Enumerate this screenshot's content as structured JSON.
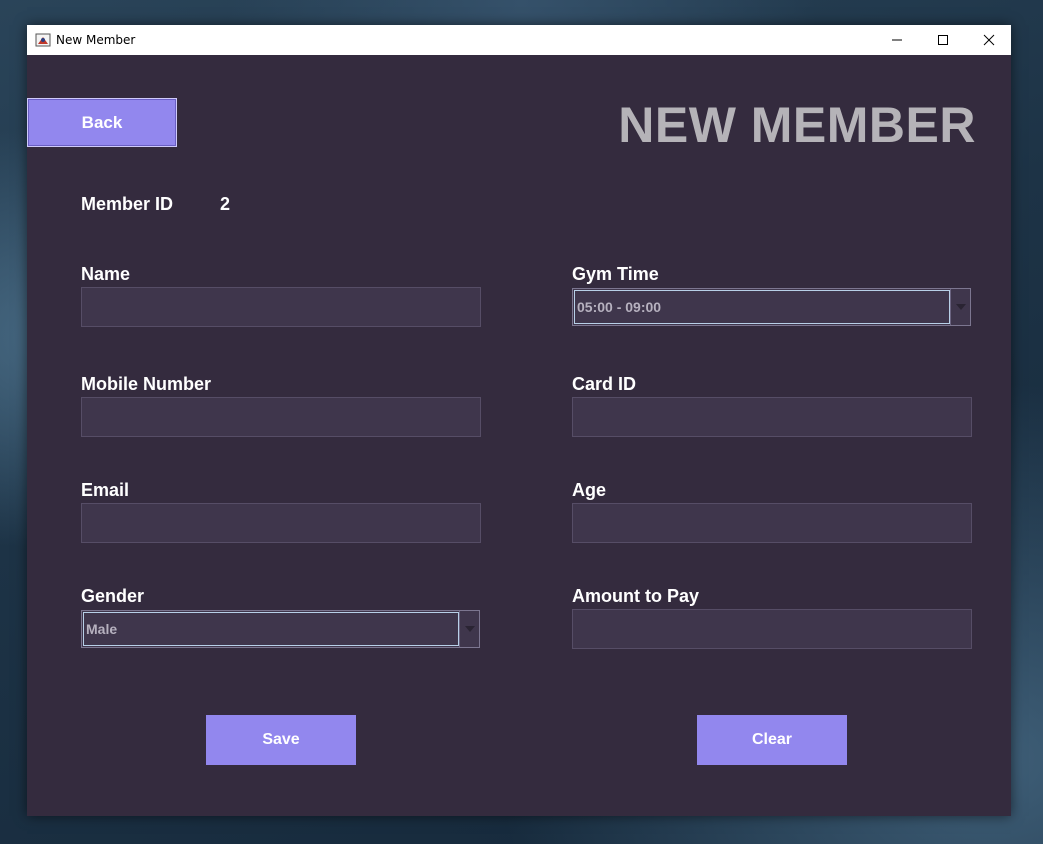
{
  "window": {
    "title": "New Member"
  },
  "header": {
    "back_label": "Back",
    "page_title": "NEW MEMBER"
  },
  "member": {
    "id_label": "Member ID",
    "id_value": "2"
  },
  "form": {
    "name": {
      "label": "Name",
      "value": ""
    },
    "mobile": {
      "label": "Mobile Number",
      "value": ""
    },
    "email": {
      "label": "Email",
      "value": ""
    },
    "gender": {
      "label": "Gender",
      "selected": "Male"
    },
    "gym_time": {
      "label": "Gym Time",
      "selected": "05:00 - 09:00"
    },
    "card_id": {
      "label": "Card ID",
      "value": ""
    },
    "age": {
      "label": "Age",
      "value": ""
    },
    "amount": {
      "label": "Amount to Pay",
      "value": ""
    }
  },
  "actions": {
    "save_label": "Save",
    "clear_label": "Clear"
  },
  "colors": {
    "background": "#342b3e",
    "accent": "#9287ee",
    "field": "#3f364c",
    "title_text": "#b5b3b8"
  }
}
